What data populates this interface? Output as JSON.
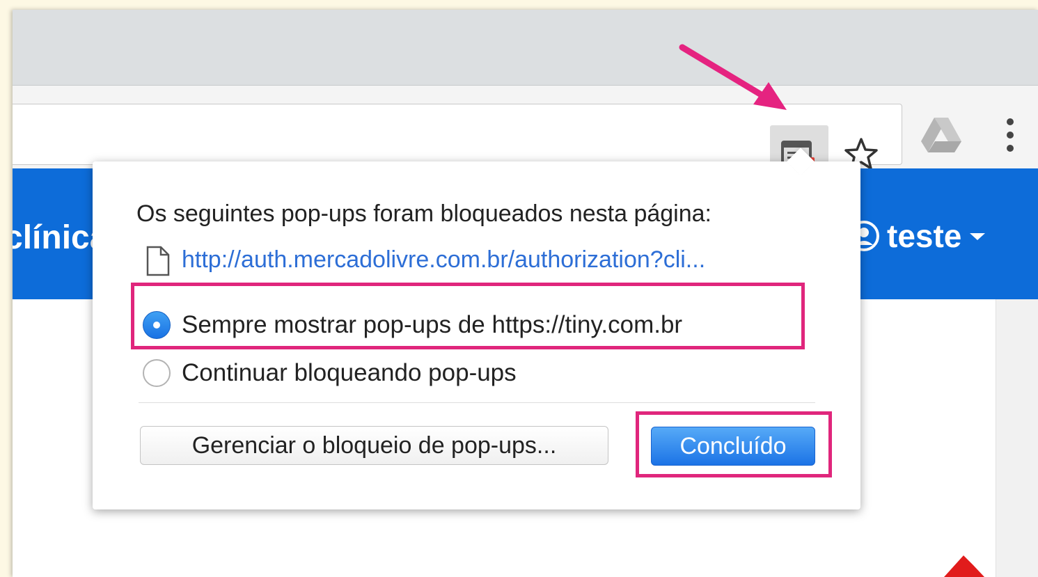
{
  "browser": {
    "toolbar": {
      "popup_blocked_icon": "popup-blocked-icon",
      "star_icon": "star-icon",
      "drive_icon": "drive-icon",
      "menu_icon": "kebab-menu-icon"
    }
  },
  "app": {
    "brand_partial": "clínica",
    "user_name": "teste",
    "header_color": "#0d6cd9"
  },
  "popup_bubble": {
    "title": "Os seguintes pop-ups foram bloqueados nesta página:",
    "blocked_url": "http://auth.mercadolivre.com.br/authorization?cli...",
    "options": [
      {
        "label": "Sempre mostrar pop-ups de https://tiny.com.br",
        "selected": true
      },
      {
        "label": "Continuar bloqueando pop-ups",
        "selected": false
      }
    ],
    "manage_button": "Gerenciar o bloqueio de pop-ups...",
    "done_button": "Concluído"
  },
  "annotations": {
    "highlight_color": "#e0267c",
    "arrow_color": "#e52380"
  }
}
